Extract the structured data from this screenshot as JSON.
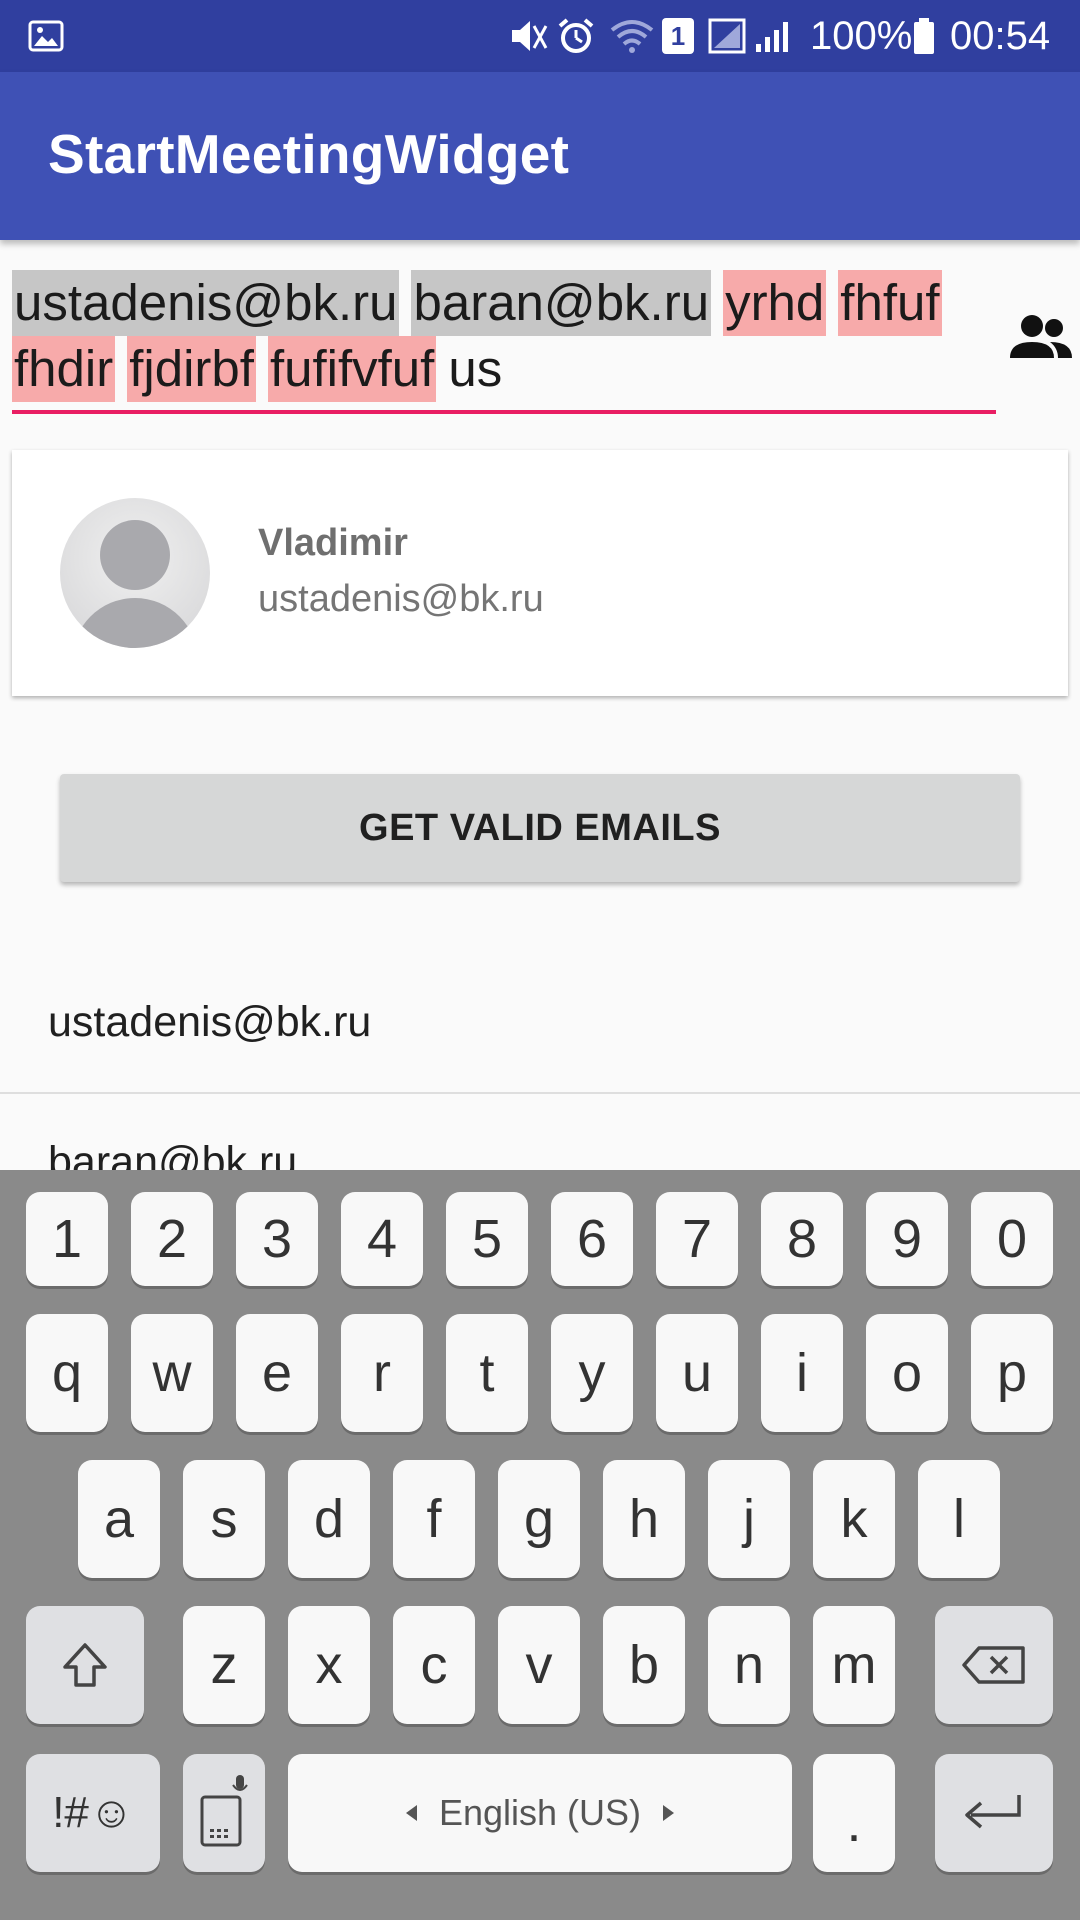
{
  "status_bar": {
    "battery": "100%",
    "time": "00:54",
    "sim": "1"
  },
  "app_bar": {
    "title": "StartMeetingWidget"
  },
  "recipients": {
    "row1": [
      {
        "text": "ustadenis@bk.ru",
        "state": "valid"
      },
      {
        "text": "baran@bk.ru",
        "state": "valid"
      },
      {
        "text": "yrhd",
        "state": "invalid"
      },
      {
        "text": "fhfuf",
        "state": "invalid"
      }
    ],
    "row2": [
      {
        "text": "fhdir",
        "state": "invalid"
      },
      {
        "text": "fjdirbf",
        "state": "invalid"
      },
      {
        "text": "fufifvfuf",
        "state": "invalid"
      }
    ],
    "typed_text": "us",
    "colors": {
      "valid_chip": "#c6c6c6",
      "invalid_chip": "#f7aaaa",
      "underline": "#e91e63"
    }
  },
  "suggestion": {
    "name": "Vladimir",
    "email": "ustadenis@bk.ru"
  },
  "get_valid_button": {
    "label": "GET VALID EMAILS"
  },
  "email_list": [
    "ustadenis@bk.ru",
    "baran@bk.ru"
  ],
  "keyboard": {
    "number_row": [
      "1",
      "2",
      "3",
      "4",
      "5",
      "6",
      "7",
      "8",
      "9",
      "0"
    ],
    "row_q": [
      "q",
      "w",
      "e",
      "r",
      "t",
      "y",
      "u",
      "i",
      "o",
      "p"
    ],
    "row_a": [
      "a",
      "s",
      "d",
      "f",
      "g",
      "h",
      "j",
      "k",
      "l"
    ],
    "row_z": [
      "z",
      "x",
      "c",
      "v",
      "b",
      "n",
      "m"
    ],
    "symbols_label": "!#☺",
    "space_label": "English (US)",
    "period_label": "."
  }
}
